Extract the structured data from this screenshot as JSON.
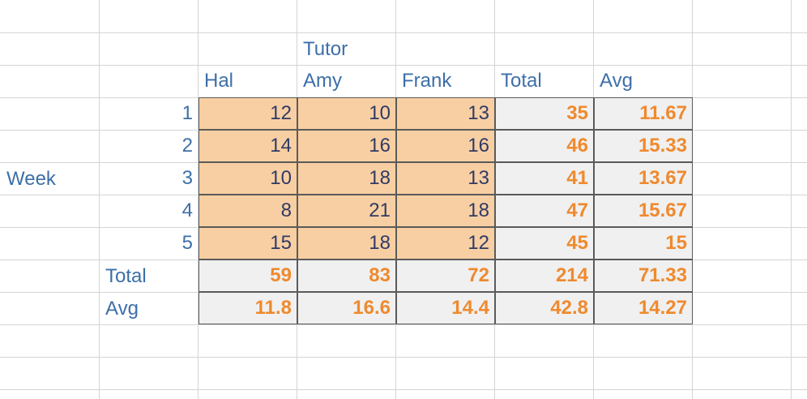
{
  "colors": {
    "label_blue": "#3d6fa8",
    "value_dark": "#2f3a66",
    "computed_orange": "#ef8a2e",
    "data_fill": "#f8cfa2",
    "summary_fill": "#f0f0f0",
    "gridline": "#d4d4d4"
  },
  "labels": {
    "tutor": "Tutor",
    "week": "Week",
    "columns": [
      "Hal",
      "Amy",
      "Frank",
      "Total",
      "Avg"
    ],
    "weeks": [
      "1",
      "2",
      "3",
      "4",
      "5"
    ],
    "total_row": "Total",
    "avg_row": "Avg"
  },
  "data_rows": [
    {
      "values": [
        "12",
        "10",
        "13"
      ],
      "total": "35",
      "avg": "11.67"
    },
    {
      "values": [
        "14",
        "16",
        "16"
      ],
      "total": "46",
      "avg": "15.33"
    },
    {
      "values": [
        "10",
        "18",
        "13"
      ],
      "total": "41",
      "avg": "13.67"
    },
    {
      "values": [
        "8",
        "21",
        "18"
      ],
      "total": "47",
      "avg": "15.67"
    },
    {
      "values": [
        "15",
        "18",
        "12"
      ],
      "total": "45",
      "avg": "15"
    }
  ],
  "total_row": [
    "59",
    "83",
    "72",
    "214",
    "71.33"
  ],
  "avg_row": [
    "11.8",
    "16.6",
    "14.4",
    "42.8",
    "14.27"
  ]
}
